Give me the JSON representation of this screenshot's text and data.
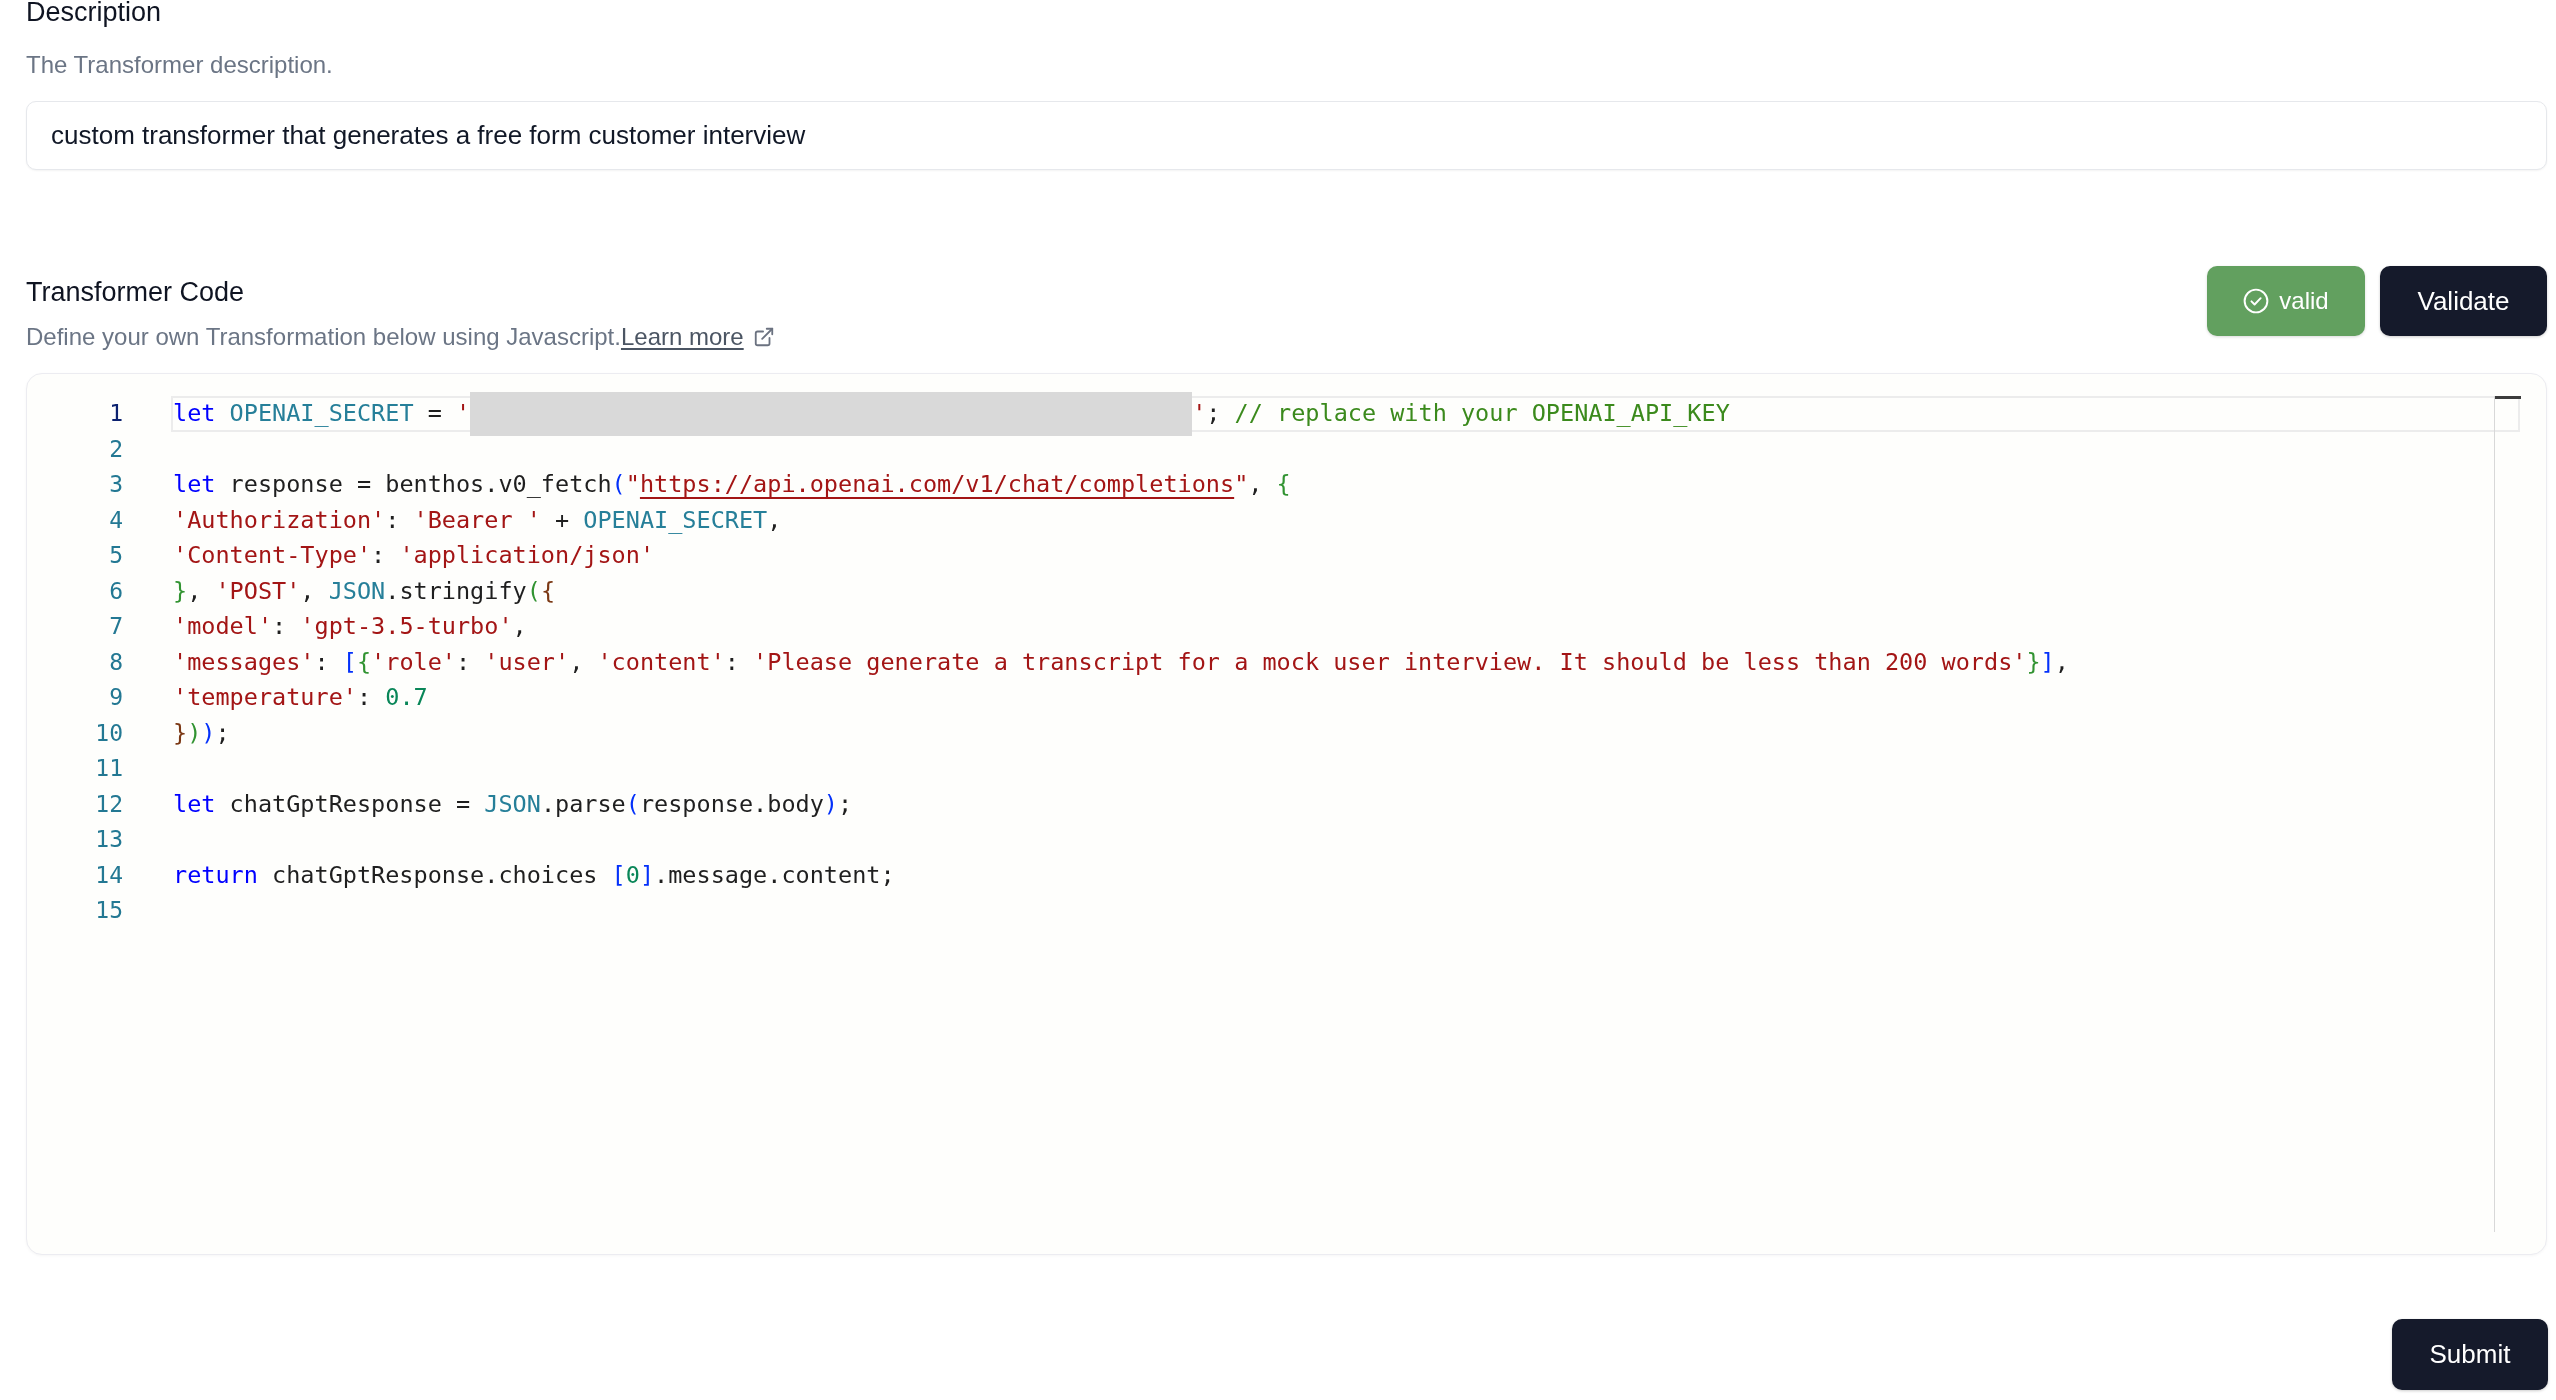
{
  "description_field": {
    "label": "Description",
    "help_text": "The Transformer description.",
    "value": "custom transformer that generates a free form customer interview"
  },
  "code_section": {
    "title": "Transformer Code",
    "description": "Define your own Transformation below using Javascript.",
    "link": "Learn more",
    "validation": {
      "label": "valid",
      "valid": true
    },
    "validate_button": "Validate"
  },
  "editor": {
    "lines": [
      {
        "number": "1",
        "current": true,
        "tokens": [
          {
            "kind": "keyword",
            "text": "let"
          },
          {
            "kind": "constant",
            "text": " OPENAI_SECRET"
          },
          {
            "kind": "plain",
            "text": " = "
          },
          {
            "kind": "string",
            "text": "'"
          },
          {
            "kind": "redacted"
          },
          {
            "kind": "string",
            "text": "'"
          },
          {
            "kind": "plain",
            "text": "; "
          },
          {
            "kind": "comment",
            "text": "// replace with your OPENAI_API_KEY"
          }
        ]
      },
      {
        "number": "2",
        "current": false
      },
      {
        "number": "3",
        "current": false,
        "tokens": [
          {
            "kind": "keyword",
            "text": "let"
          },
          {
            "kind": "plain",
            "text": " response = benthos.v0_fetch"
          },
          {
            "kind": "bracket1",
            "text": "("
          },
          {
            "kind": "string",
            "text": "\""
          },
          {
            "kind": "link",
            "text": "https://api.openai.com/v1/chat/completions"
          },
          {
            "kind": "string",
            "text": "\""
          },
          {
            "kind": "plain",
            "text": ", "
          },
          {
            "kind": "bracket2",
            "text": "{"
          }
        ]
      },
      {
        "number": "4",
        "current": false,
        "tokens": [
          {
            "kind": "string",
            "text": "'Authorization'"
          },
          {
            "kind": "plain",
            "text": ": "
          },
          {
            "kind": "string",
            "text": "'Bearer '"
          },
          {
            "kind": "plain",
            "text": " + "
          },
          {
            "kind": "constant",
            "text": "OPENAI_SECRET"
          },
          {
            "kind": "plain",
            "text": ","
          }
        ]
      },
      {
        "number": "5",
        "current": false,
        "tokens": [
          {
            "kind": "string",
            "text": "'Content-Type'"
          },
          {
            "kind": "plain",
            "text": ": "
          },
          {
            "kind": "string",
            "text": "'application/json'"
          }
        ]
      },
      {
        "number": "6",
        "current": false,
        "tokens": [
          {
            "kind": "bracket2",
            "text": "}"
          },
          {
            "kind": "plain",
            "text": ", "
          },
          {
            "kind": "string",
            "text": "'POST'"
          },
          {
            "kind": "plain",
            "text": ", "
          },
          {
            "kind": "constant",
            "text": "JSON"
          },
          {
            "kind": "plain",
            "text": ".stringify"
          },
          {
            "kind": "bracket2",
            "text": "("
          },
          {
            "kind": "bracket3",
            "text": "{"
          }
        ]
      },
      {
        "number": "7",
        "current": false,
        "tokens": [
          {
            "kind": "string",
            "text": "'model'"
          },
          {
            "kind": "plain",
            "text": ": "
          },
          {
            "kind": "string",
            "text": "'gpt-3.5-turbo'"
          },
          {
            "kind": "plain",
            "text": ","
          }
        ]
      },
      {
        "number": "8",
        "current": false,
        "tokens": [
          {
            "kind": "string",
            "text": "'messages'"
          },
          {
            "kind": "plain",
            "text": ": "
          },
          {
            "kind": "bracket1",
            "text": "["
          },
          {
            "kind": "bracket2",
            "text": "{"
          },
          {
            "kind": "string",
            "text": "'role'"
          },
          {
            "kind": "plain",
            "text": ": "
          },
          {
            "kind": "string",
            "text": "'user'"
          },
          {
            "kind": "plain",
            "text": ", "
          },
          {
            "kind": "string",
            "text": "'content'"
          },
          {
            "kind": "plain",
            "text": ": "
          },
          {
            "kind": "string",
            "text": "'Please generate a transcript for a mock user interview. It should be less than 200 words'"
          },
          {
            "kind": "bracket2",
            "text": "}"
          },
          {
            "kind": "bracket1",
            "text": "]"
          },
          {
            "kind": "plain",
            "text": ","
          }
        ]
      },
      {
        "number": "9",
        "current": false,
        "tokens": [
          {
            "kind": "string",
            "text": "'temperature'"
          },
          {
            "kind": "plain",
            "text": ": "
          },
          {
            "kind": "number",
            "text": "0.7"
          }
        ]
      },
      {
        "number": "10",
        "current": false,
        "tokens": [
          {
            "kind": "bracket3",
            "text": "}"
          },
          {
            "kind": "bracket2",
            "text": ")"
          },
          {
            "kind": "bracket1",
            "text": ")"
          },
          {
            "kind": "plain",
            "text": ";"
          }
        ]
      },
      {
        "number": "11",
        "current": false
      },
      {
        "number": "12",
        "current": false,
        "tokens": [
          {
            "kind": "keyword",
            "text": "let"
          },
          {
            "kind": "plain",
            "text": " chatGptResponse = "
          },
          {
            "kind": "constant",
            "text": "JSON"
          },
          {
            "kind": "plain",
            "text": ".parse"
          },
          {
            "kind": "bracket1",
            "text": "("
          },
          {
            "kind": "plain",
            "text": "response.body"
          },
          {
            "kind": "bracket1",
            "text": ")"
          },
          {
            "kind": "plain",
            "text": ";"
          }
        ]
      },
      {
        "number": "13",
        "current": false
      },
      {
        "number": "14",
        "current": false,
        "tokens": [
          {
            "kind": "keyword",
            "text": "return"
          },
          {
            "kind": "plain",
            "text": " chatGptResponse.choices "
          },
          {
            "kind": "bracket1",
            "text": "["
          },
          {
            "kind": "number",
            "text": "0"
          },
          {
            "kind": "bracket1",
            "text": "]"
          },
          {
            "kind": "plain",
            "text": ".message.content;"
          }
        ]
      },
      {
        "number": "15",
        "current": false
      }
    ]
  },
  "submit_button": "Submit"
}
